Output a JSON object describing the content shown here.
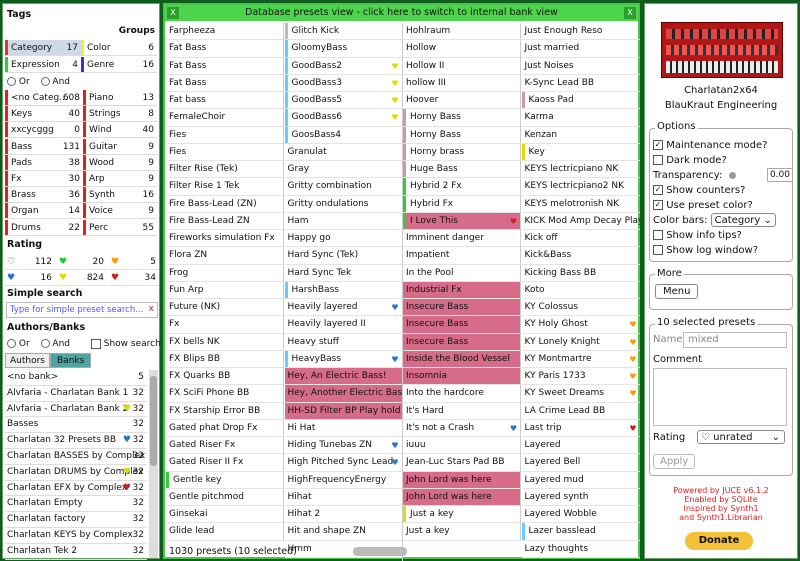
{
  "tags": {
    "title": "Tags",
    "groups_label": "Groups",
    "groups": [
      {
        "name": "Category",
        "count": "17",
        "color": "#d33"
      },
      {
        "name": "Color",
        "count": "6",
        "color": "#ee3"
      },
      {
        "name": "Expression",
        "count": "4",
        "color": "#3c3"
      },
      {
        "name": "Genre",
        "count": "16",
        "color": "#33d"
      }
    ],
    "or_label": "Or",
    "and_label": "And",
    "items_left": [
      {
        "name": "<no Categ...",
        "count": "608",
        "color": "#d22"
      },
      {
        "name": "Keys",
        "count": "40",
        "color": "#d22"
      },
      {
        "name": "xxcycggg",
        "count": "0",
        "color": "#d22"
      },
      {
        "name": "Bass",
        "count": "131",
        "color": "#d22"
      },
      {
        "name": "Pads",
        "count": "38",
        "color": "#d22"
      },
      {
        "name": "Fx",
        "count": "30",
        "color": "#d22"
      },
      {
        "name": "Brass",
        "count": "36",
        "color": "#d22"
      },
      {
        "name": "Organ",
        "count": "14",
        "color": "#d22"
      },
      {
        "name": "Drums",
        "count": "22",
        "color": "#d22"
      }
    ],
    "items_right": [
      {
        "name": "Piano",
        "count": "13",
        "color": "#d22"
      },
      {
        "name": "Strings",
        "count": "8",
        "color": "#d22"
      },
      {
        "name": "Wind",
        "count": "40",
        "color": "#d22"
      },
      {
        "name": "Guitar",
        "count": "9",
        "color": "#d22"
      },
      {
        "name": "Wood",
        "count": "9",
        "color": "#d22"
      },
      {
        "name": "Arp",
        "count": "9",
        "color": "#d22"
      },
      {
        "name": "Synth",
        "count": "16",
        "color": "#d22"
      },
      {
        "name": "Voice",
        "count": "9",
        "color": "#d22"
      },
      {
        "name": "Perc",
        "count": "55",
        "color": "#d22"
      }
    ]
  },
  "rating": {
    "title": "Rating",
    "items": [
      {
        "icon": "♡",
        "count": "112",
        "color": "#333"
      },
      {
        "icon": "♥",
        "count": "20",
        "color": "#2c2"
      },
      {
        "icon": "♥",
        "count": "5",
        "color": "#f90"
      },
      {
        "icon": "♥",
        "count": "16",
        "color": "#27c"
      },
      {
        "icon": "♥",
        "count": "824",
        "color": "#dd0"
      },
      {
        "icon": "♥",
        "count": "34",
        "color": "#c22"
      }
    ]
  },
  "search": {
    "title": "Simple search",
    "placeholder": "Type for simple preset search...",
    "clear": "x"
  },
  "authors": {
    "title": "Authors/Banks",
    "or_label": "Or",
    "and_label": "And",
    "show_search": "Show search",
    "tab_authors": "Authors",
    "tab_banks": "Banks",
    "items": [
      {
        "name": "<no bank>",
        "count": "5",
        "icon": "",
        "color": ""
      },
      {
        "name": "Alvfaria - Charlatan Bank 1",
        "count": "32",
        "icon": "",
        "color": ""
      },
      {
        "name": "Alvfaria - Charlatan Bank 2",
        "count": "32",
        "icon": "♥",
        "color": "#dd0"
      },
      {
        "name": "Basses",
        "count": "32",
        "icon": "",
        "color": ""
      },
      {
        "name": "Charlatan 32 Presets BB",
        "count": "32",
        "icon": "♥",
        "color": "#27c"
      },
      {
        "name": "Charlatan BASSES by Complex",
        "count": "32",
        "icon": "",
        "color": ""
      },
      {
        "name": "Charlatan DRUMS by Complex",
        "count": "32",
        "icon": "♥",
        "color": "#dd0"
      },
      {
        "name": "Charlatan EFX by Complex",
        "count": "32",
        "icon": "♥",
        "color": "#c22"
      },
      {
        "name": "Charlatan Empty",
        "count": "32",
        "icon": "",
        "color": ""
      },
      {
        "name": "Charlatan factory",
        "count": "32",
        "icon": "",
        "color": ""
      },
      {
        "name": "Charlatan KEYS by Complex",
        "count": "32",
        "icon": "",
        "color": ""
      },
      {
        "name": "Charlatan Tek 2",
        "count": "32",
        "icon": "",
        "color": ""
      }
    ]
  },
  "db": {
    "title": "Database presets view - click here to switch to internal bank view",
    "close": "X",
    "status": "1030 presets (10 selected)",
    "columns": [
      [
        {
          "n": "Farpheeza"
        },
        {
          "n": "Fat Bass"
        },
        {
          "n": "Fat Bass"
        },
        {
          "n": "Fat Bass"
        },
        {
          "n": "Fat bass"
        },
        {
          "n": "FemaleChoir"
        },
        {
          "n": "Fies"
        },
        {
          "n": "Fies"
        },
        {
          "n": "Filter Rise (Tek)"
        },
        {
          "n": "Filter Rise 1 Tek"
        },
        {
          "n": "Fire Bass-Lead (ZN)"
        },
        {
          "n": "Fire Bass-Lead ZN"
        },
        {
          "n": "Fireworks simulation Fx"
        },
        {
          "n": "Flora ZN"
        },
        {
          "n": "Frog"
        },
        {
          "n": "Fun Arp"
        },
        {
          "n": "Future (NK)"
        },
        {
          "n": "Fx"
        },
        {
          "n": "FX bells NK"
        },
        {
          "n": "FX Blips BB"
        },
        {
          "n": "FX Quarks BB"
        },
        {
          "n": "FX SciFi Phone BB"
        },
        {
          "n": "FX Starship Error BB"
        },
        {
          "n": "Gated phat Drop Fx"
        },
        {
          "n": "Gated Riser Fx"
        },
        {
          "n": "Gated Riser II Fx"
        },
        {
          "n": "Gentle key",
          "c": "#3c3"
        },
        {
          "n": "Gentle pitchmod"
        },
        {
          "n": "Ginsekai"
        },
        {
          "n": "Glide lead"
        }
      ],
      [
        {
          "n": "Glitch Kick",
          "c": "#bbb"
        },
        {
          "n": "GloomyBass",
          "c": "#6cf"
        },
        {
          "n": "GoodBass2",
          "c": "#6cf",
          "i": "♥",
          "ic": "#dd0"
        },
        {
          "n": "GoodBass3",
          "c": "#6cf",
          "i": "♥",
          "ic": "#dd0"
        },
        {
          "n": "GoodBass5",
          "c": "#6cf",
          "i": "♥",
          "ic": "#dd0"
        },
        {
          "n": "GoodBass6",
          "c": "#6cf",
          "i": "♥",
          "ic": "#dd0"
        },
        {
          "n": "GoosBass4",
          "c": "#6cf"
        },
        {
          "n": "Granulat"
        },
        {
          "n": "Gray"
        },
        {
          "n": "Gritty combination"
        },
        {
          "n": "Gritty ondulations"
        },
        {
          "n": "Ham"
        },
        {
          "n": "Happy go"
        },
        {
          "n": "Hard Sync (Tek)"
        },
        {
          "n": "Hard Sync Tek"
        },
        {
          "n": "HarshBass",
          "c": "#6cf"
        },
        {
          "n": "Heavily layered",
          "i": "♥",
          "ic": "#27c"
        },
        {
          "n": "Heavily layered II"
        },
        {
          "n": "Heavy stuff"
        },
        {
          "n": "HeavyBass",
          "c": "#6cf",
          "i": "♥",
          "ic": "#27c"
        },
        {
          "n": "Hey, An Electric Bass!",
          "p": 1
        },
        {
          "n": "Hey, Another Electric Bass!",
          "p": 1
        },
        {
          "n": "HH-SD Filter BP Play hold ZN",
          "p": 1
        },
        {
          "n": "Hi Hat"
        },
        {
          "n": "Hiding Tunebas ZN",
          "i": "♥",
          "ic": "#27c"
        },
        {
          "n": "High Pitched Sync Lead",
          "i": "♥",
          "ic": "#27c"
        },
        {
          "n": "HighFrequencyEnergy"
        },
        {
          "n": "Hihat"
        },
        {
          "n": "Hihat 2"
        },
        {
          "n": "Hit and shape ZN"
        },
        {
          "n": "Hmm"
        },
        {
          "n": "Hmm"
        }
      ],
      [
        {
          "n": "Hohlraum"
        },
        {
          "n": "Hollow"
        },
        {
          "n": "Hollow II"
        },
        {
          "n": "hollow III"
        },
        {
          "n": "Hoover"
        },
        {
          "n": "Horny Bass",
          "c": "#c9a"
        },
        {
          "n": "Horny Bass",
          "c": "#c9a"
        },
        {
          "n": "Horny brass",
          "c": "#c9a"
        },
        {
          "n": "Huge Bass",
          "c": "#c9a"
        },
        {
          "n": "Hybrid 2 Fx",
          "c": "#3c3"
        },
        {
          "n": "Hybrid Fx",
          "c": "#3c3"
        },
        {
          "n": "I Love This",
          "c": "#3c3",
          "i": "♥",
          "ic": "#c22",
          "sel": 1
        },
        {
          "n": "Imminent danger"
        },
        {
          "n": "Impatient"
        },
        {
          "n": "In the Pool"
        },
        {
          "n": "Industrial Fx",
          "p": 1
        },
        {
          "n": "Insecure Bass",
          "p": 1
        },
        {
          "n": "Insecure Bass",
          "p": 1
        },
        {
          "n": "Insecure Bass",
          "p": 1
        },
        {
          "n": "Inside the Blood Vessel",
          "p": 1
        },
        {
          "n": "Insomnia",
          "p": 1
        },
        {
          "n": "Into the hardcore"
        },
        {
          "n": "It's Hard"
        },
        {
          "n": "It's not a Crash",
          "i": "♥",
          "ic": "#27c"
        },
        {
          "n": "iuuu"
        },
        {
          "n": "Jean-Luc Stars Pad BB"
        },
        {
          "n": "John Lord was here",
          "p": 1
        },
        {
          "n": "John Lord was here",
          "p": 1
        },
        {
          "n": "Just a key",
          "c": "#dd0"
        },
        {
          "n": "Just a key"
        }
      ],
      [
        {
          "n": "Just Enough Reso"
        },
        {
          "n": "Just married"
        },
        {
          "n": "Just Noises"
        },
        {
          "n": "K-Sync Lead BB"
        },
        {
          "n": "Kaoss Pad",
          "c": "#c9a"
        },
        {
          "n": "Karma"
        },
        {
          "n": "Kenzan"
        },
        {
          "n": "Key",
          "c": "#dd0"
        },
        {
          "n": "KEYS lectricpiano NK"
        },
        {
          "n": "KEYS lectricpiano2 NK"
        },
        {
          "n": "KEYS melotronish NK"
        },
        {
          "n": "KICK Mod Amp Decay Play ZN"
        },
        {
          "n": "Kick off"
        },
        {
          "n": "Kick&Bass"
        },
        {
          "n": "Kicking Bass BB"
        },
        {
          "n": "Koto"
        },
        {
          "n": "KY Colossus"
        },
        {
          "n": "KY Holy Ghost",
          "i": "♥",
          "ic": "#f90"
        },
        {
          "n": "KY Lonely Knight",
          "i": "♥",
          "ic": "#f90"
        },
        {
          "n": "KY Montmartre",
          "i": "♥",
          "ic": "#f90"
        },
        {
          "n": "KY Paris 1733",
          "i": "♥",
          "ic": "#f90"
        },
        {
          "n": "KY Sweet Dreams",
          "i": "♥",
          "ic": "#f90"
        },
        {
          "n": "LA Crime Lead BB"
        },
        {
          "n": "Last trip",
          "i": "♥",
          "ic": "#c22"
        },
        {
          "n": "Layered"
        },
        {
          "n": "Layered Bell"
        },
        {
          "n": "Layered mud"
        },
        {
          "n": "Layered synth"
        },
        {
          "n": "Layered Wobble"
        },
        {
          "n": "Lazer basslead",
          "c": "#6cf"
        },
        {
          "n": "Lazy thoughts"
        }
      ]
    ]
  },
  "plugin": {
    "name": "Charlatan2x64",
    "vendor": "BlauKraut Engineering"
  },
  "options": {
    "title": "Options",
    "maintenance": "Maintenance mode?",
    "dark": "Dark mode?",
    "transparency": "Transparency:",
    "transparency_value": "0.00",
    "show_counters": "Show counters?",
    "use_preset_color": "Use preset color?",
    "color_bars": "Color bars:",
    "color_bars_value": "Category",
    "show_info": "Show info tips?",
    "show_log": "Show log window?"
  },
  "more": {
    "title": "More",
    "menu": "Menu"
  },
  "selected": {
    "title": "10 selected presets",
    "name_label": "Name",
    "name_placeholder": "mixed",
    "comment_label": "Comment",
    "rating_label": "Rating",
    "rating_value": "♡ unrated",
    "apply": "Apply"
  },
  "credits": {
    "line1": "Powered by JUCE v6.1.2",
    "line2": "Enabled by SQLite",
    "line3": "Inspired by Synth1",
    "line4": "and Synth1.Librarian",
    "donate": "Donate"
  }
}
